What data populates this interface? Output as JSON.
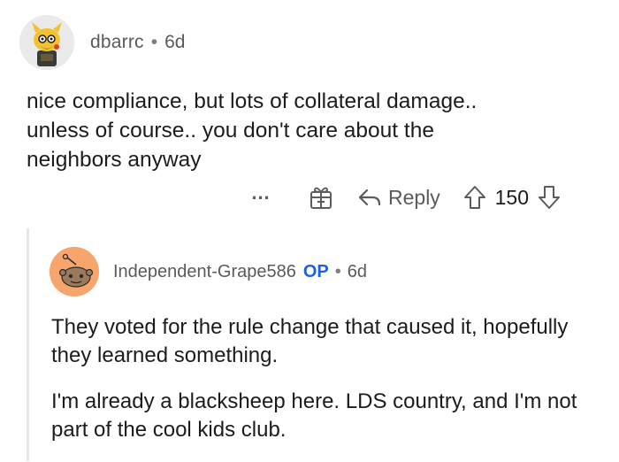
{
  "parent_comment": {
    "username": "dbarrc",
    "separator": "•",
    "time_ago": "6d",
    "body_lines": [
      "nice compliance, but lots of collateral damage..",
      "unless of course.. you don't care about the",
      "neighbors anyway"
    ],
    "actions": {
      "more_label": "...",
      "reply_label": "Reply",
      "vote_count": "150"
    }
  },
  "reply_comment": {
    "username": "Independent-Grape586",
    "op_badge": "OP",
    "separator": "•",
    "time_ago": "6d",
    "paragraphs": [
      "They voted for the rule change that caused it, hopefully they learned something.",
      "I'm already a blacksheep here.  LDS country, and I'm not part of the cool kids club."
    ]
  },
  "colors": {
    "text": "#1c1c1c",
    "meta": "#5a5a5a",
    "op_blue": "#1f63d8",
    "reply_avatar_bg": "#f7a56c",
    "thread_line": "#e6e6e6"
  }
}
